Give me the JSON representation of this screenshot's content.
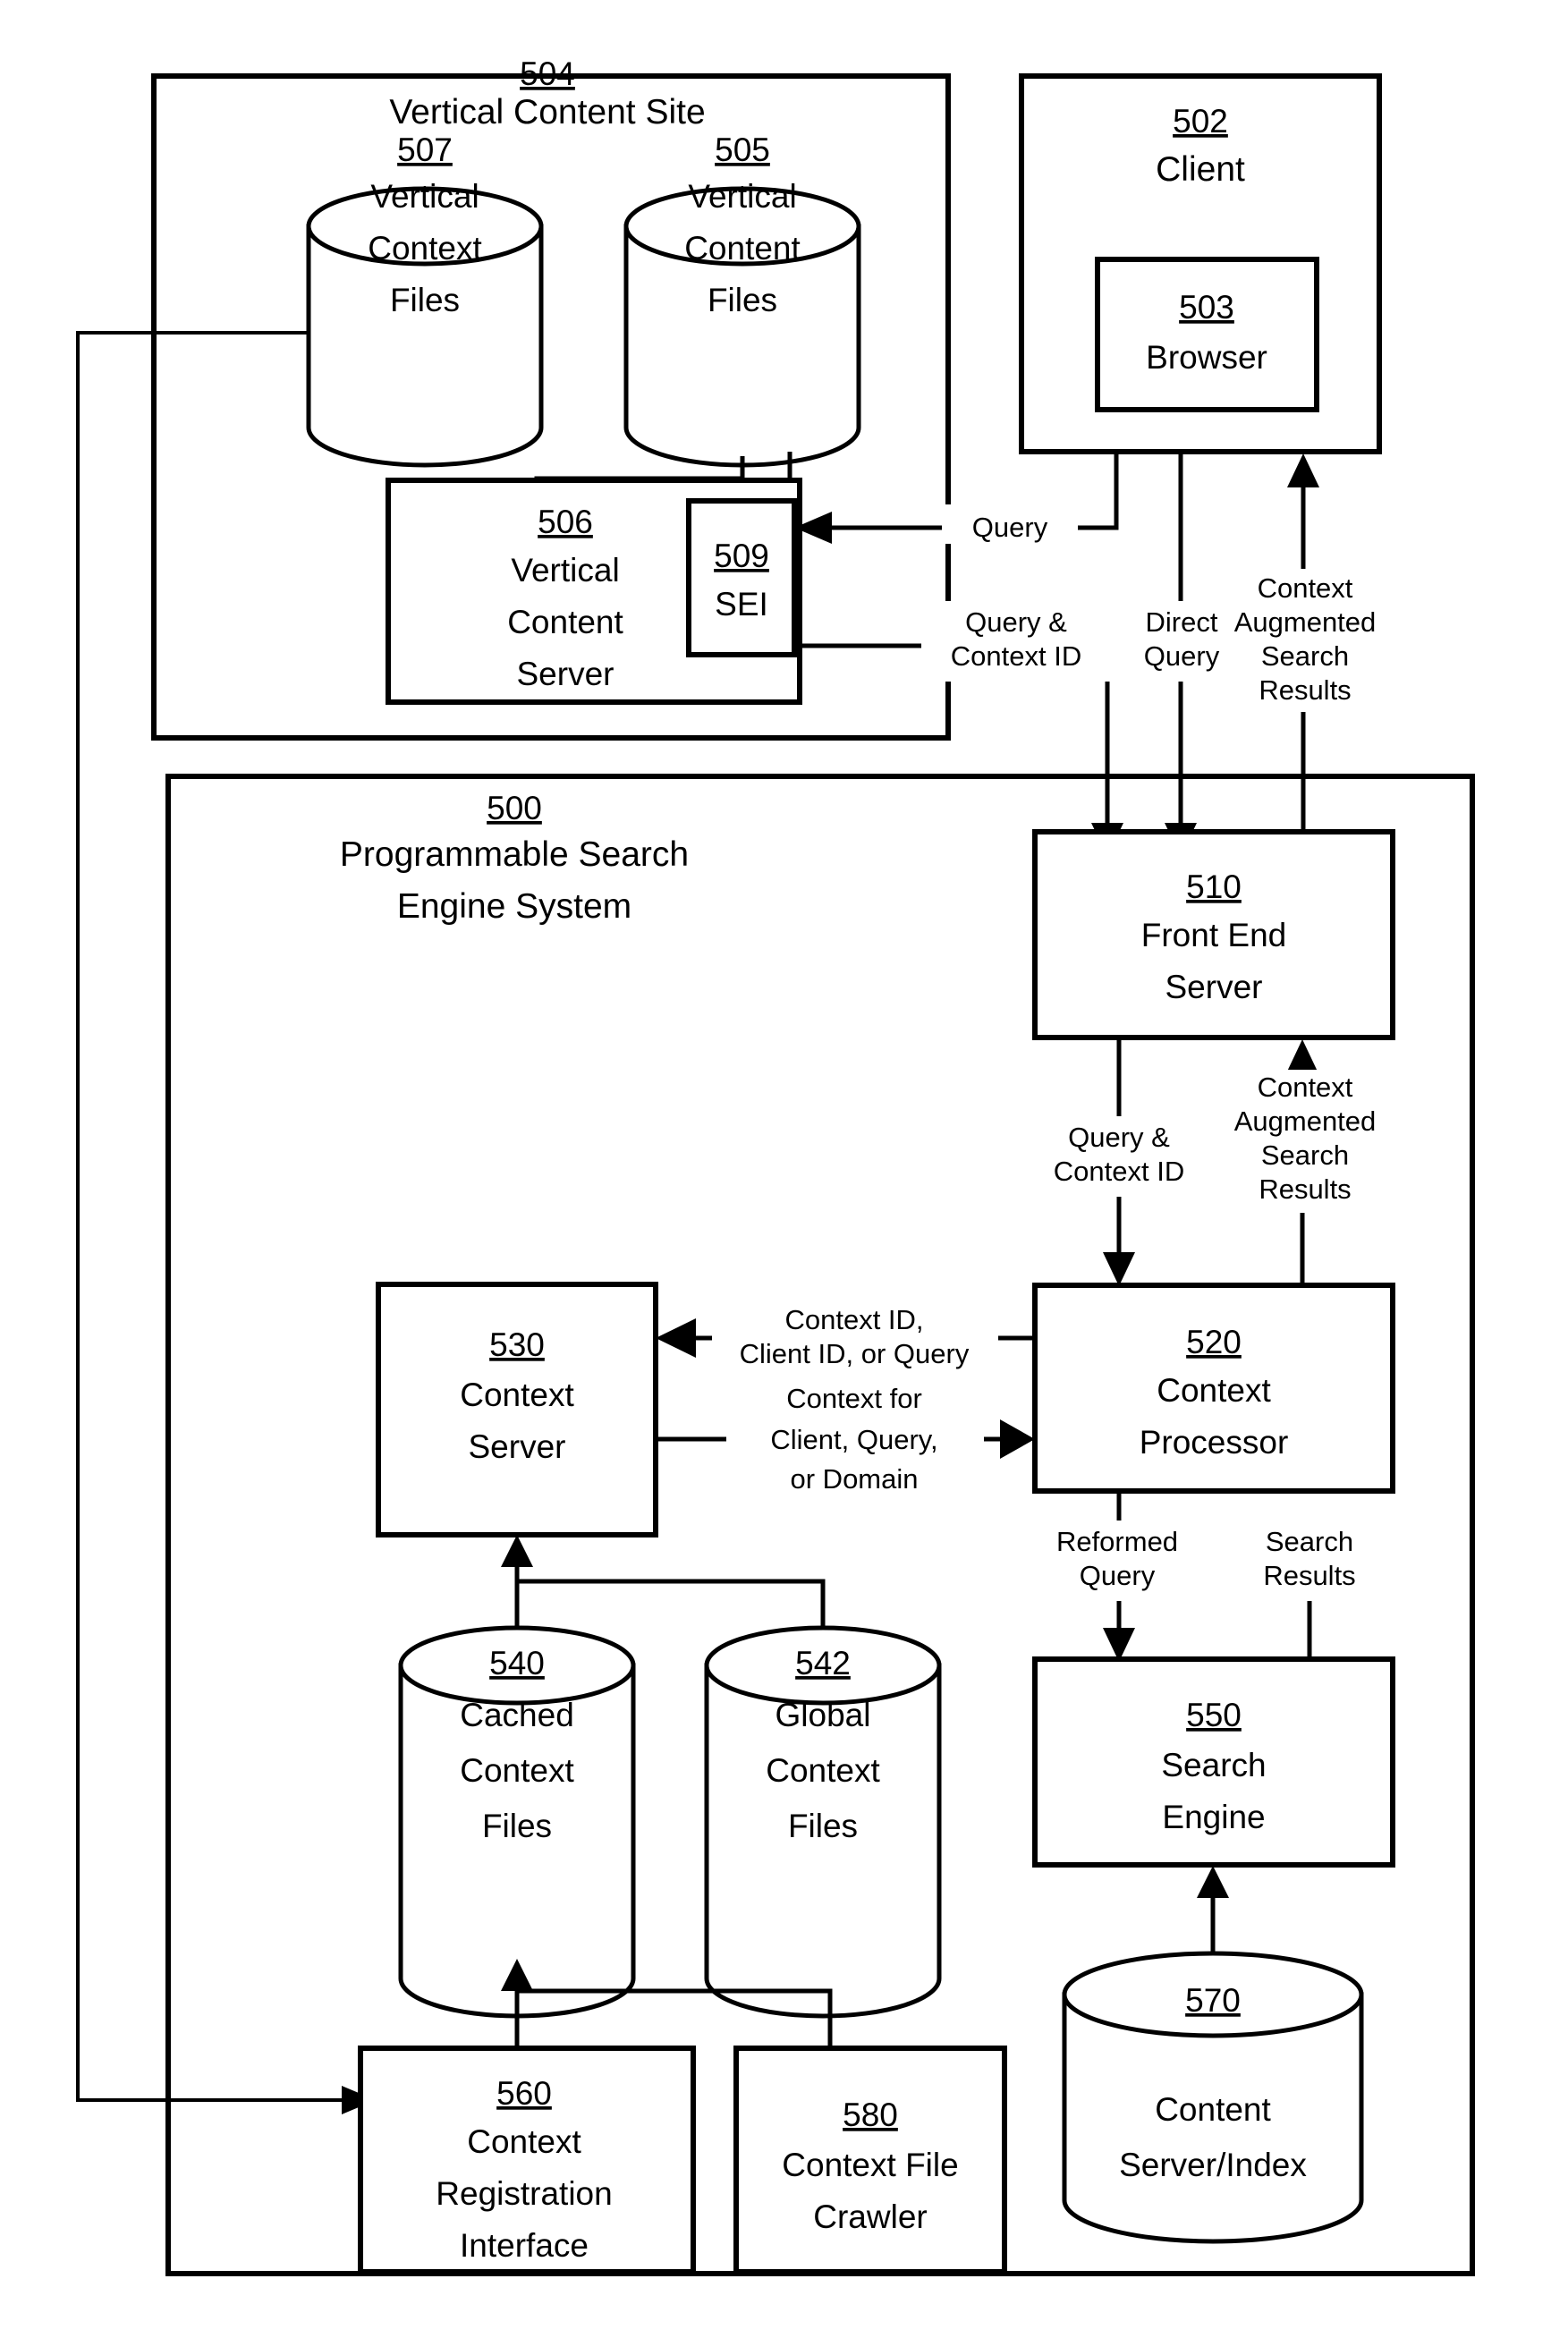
{
  "figure": {
    "title": "Programmable Search Engine System block diagram",
    "type": "patent-block-diagram"
  },
  "containers": {
    "vertical_content_site": {
      "num": "504",
      "label_line1": "Vertical Content Site"
    },
    "client": {
      "num": "502",
      "label_line1": "Client"
    },
    "search_engine_system": {
      "num": "500",
      "label_line1": "Programmable Search",
      "label_line2": "Engine System"
    }
  },
  "nodes": {
    "vertical_context_files": {
      "num": "507",
      "l1": "Vertical",
      "l2": "Context",
      "l3": "Files"
    },
    "vertical_content_files": {
      "num": "505",
      "l1": "Vertical",
      "l2": "Content",
      "l3": "Files"
    },
    "vertical_content_server": {
      "num": "506",
      "l1": "Vertical",
      "l2": "Content",
      "l3": "Server"
    },
    "sei": {
      "num": "509",
      "l1": "SEI"
    },
    "browser": {
      "num": "503",
      "l1": "Browser"
    },
    "front_end_server": {
      "num": "510",
      "l1": "Front End",
      "l2": "Server"
    },
    "context_server": {
      "num": "530",
      "l1": "Context",
      "l2": "Server"
    },
    "context_processor": {
      "num": "520",
      "l1": "Context",
      "l2": "Processor"
    },
    "cached_context_files": {
      "num": "540",
      "l1": "Cached",
      "l2": "Context",
      "l3": "Files"
    },
    "global_context_files": {
      "num": "542",
      "l1": "Global",
      "l2": "Context",
      "l3": "Files"
    },
    "search_engine": {
      "num": "550",
      "l1": "Search",
      "l2": "Engine"
    },
    "context_registration_interface": {
      "num": "560",
      "l1": "Context",
      "l2": "Registration",
      "l3": "Interface"
    },
    "context_file_crawler": {
      "num": "580",
      "l1": "Context File",
      "l2": "Crawler"
    },
    "content_server_index": {
      "num": "570",
      "l1": "Content",
      "l2": "Server/Index"
    }
  },
  "edge_labels": {
    "query": {
      "l1": "Query"
    },
    "query_context_id_top": {
      "l1": "Query &",
      "l2": "Context ID"
    },
    "direct_query": {
      "l1": "Direct",
      "l2": "Query"
    },
    "context_augmented_results_top": {
      "l1": "Context",
      "l2": "Augmented",
      "l3": "Search",
      "l4": "Results"
    },
    "query_context_id_mid": {
      "l1": "Query &",
      "l2": "Context ID"
    },
    "context_augmented_results_mid": {
      "l1": "Context",
      "l2": "Augmented",
      "l3": "Search",
      "l4": "Results"
    },
    "context_id_client_id_or_query": {
      "l1": "Context ID,",
      "l2": "Client ID, or Query"
    },
    "context_for_client_query_or_domain": {
      "l1": "Context for",
      "l2": "Client, Query,",
      "l3": "or Domain"
    },
    "reformed_query": {
      "l1": "Reformed",
      "l2": "Query"
    },
    "search_results": {
      "l1": "Search",
      "l2": "Results"
    }
  },
  "colors": {
    "stroke": "#000000",
    "background": "#ffffff",
    "text": "#000000"
  }
}
